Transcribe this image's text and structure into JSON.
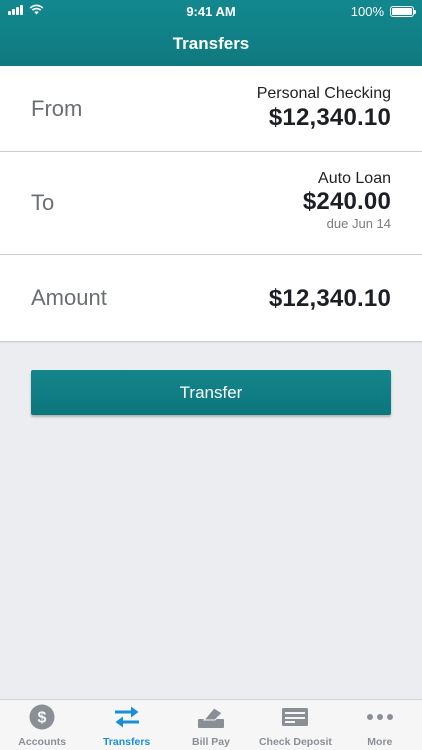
{
  "status_bar": {
    "time": "9:41 AM",
    "battery": "100%"
  },
  "header": {
    "title": "Transfers"
  },
  "from": {
    "label": "From",
    "account": "Personal Checking",
    "amount": "$12,340.10"
  },
  "to": {
    "label": "To",
    "account": "Auto Loan",
    "amount": "$240.00",
    "due": "due Jun 14"
  },
  "amount_row": {
    "label": "Amount",
    "amount": "$12,340.10"
  },
  "transfer_button": {
    "label": "Transfer"
  },
  "tabbar": {
    "items": [
      {
        "label": "Accounts",
        "icon": "dollar-circle-icon",
        "active": false
      },
      {
        "label": "Transfers",
        "icon": "transfer-arrows-icon",
        "active": true
      },
      {
        "label": "Bill Pay",
        "icon": "bill-pay-icon",
        "active": false
      },
      {
        "label": "Check Deposit",
        "icon": "check-icon",
        "active": false
      },
      {
        "label": "More",
        "icon": "more-dots-icon",
        "active": false
      }
    ]
  },
  "colors": {
    "header": "#12888e",
    "active_tab": "#1a8fd8",
    "inactive_tab": "#8a8f95"
  }
}
